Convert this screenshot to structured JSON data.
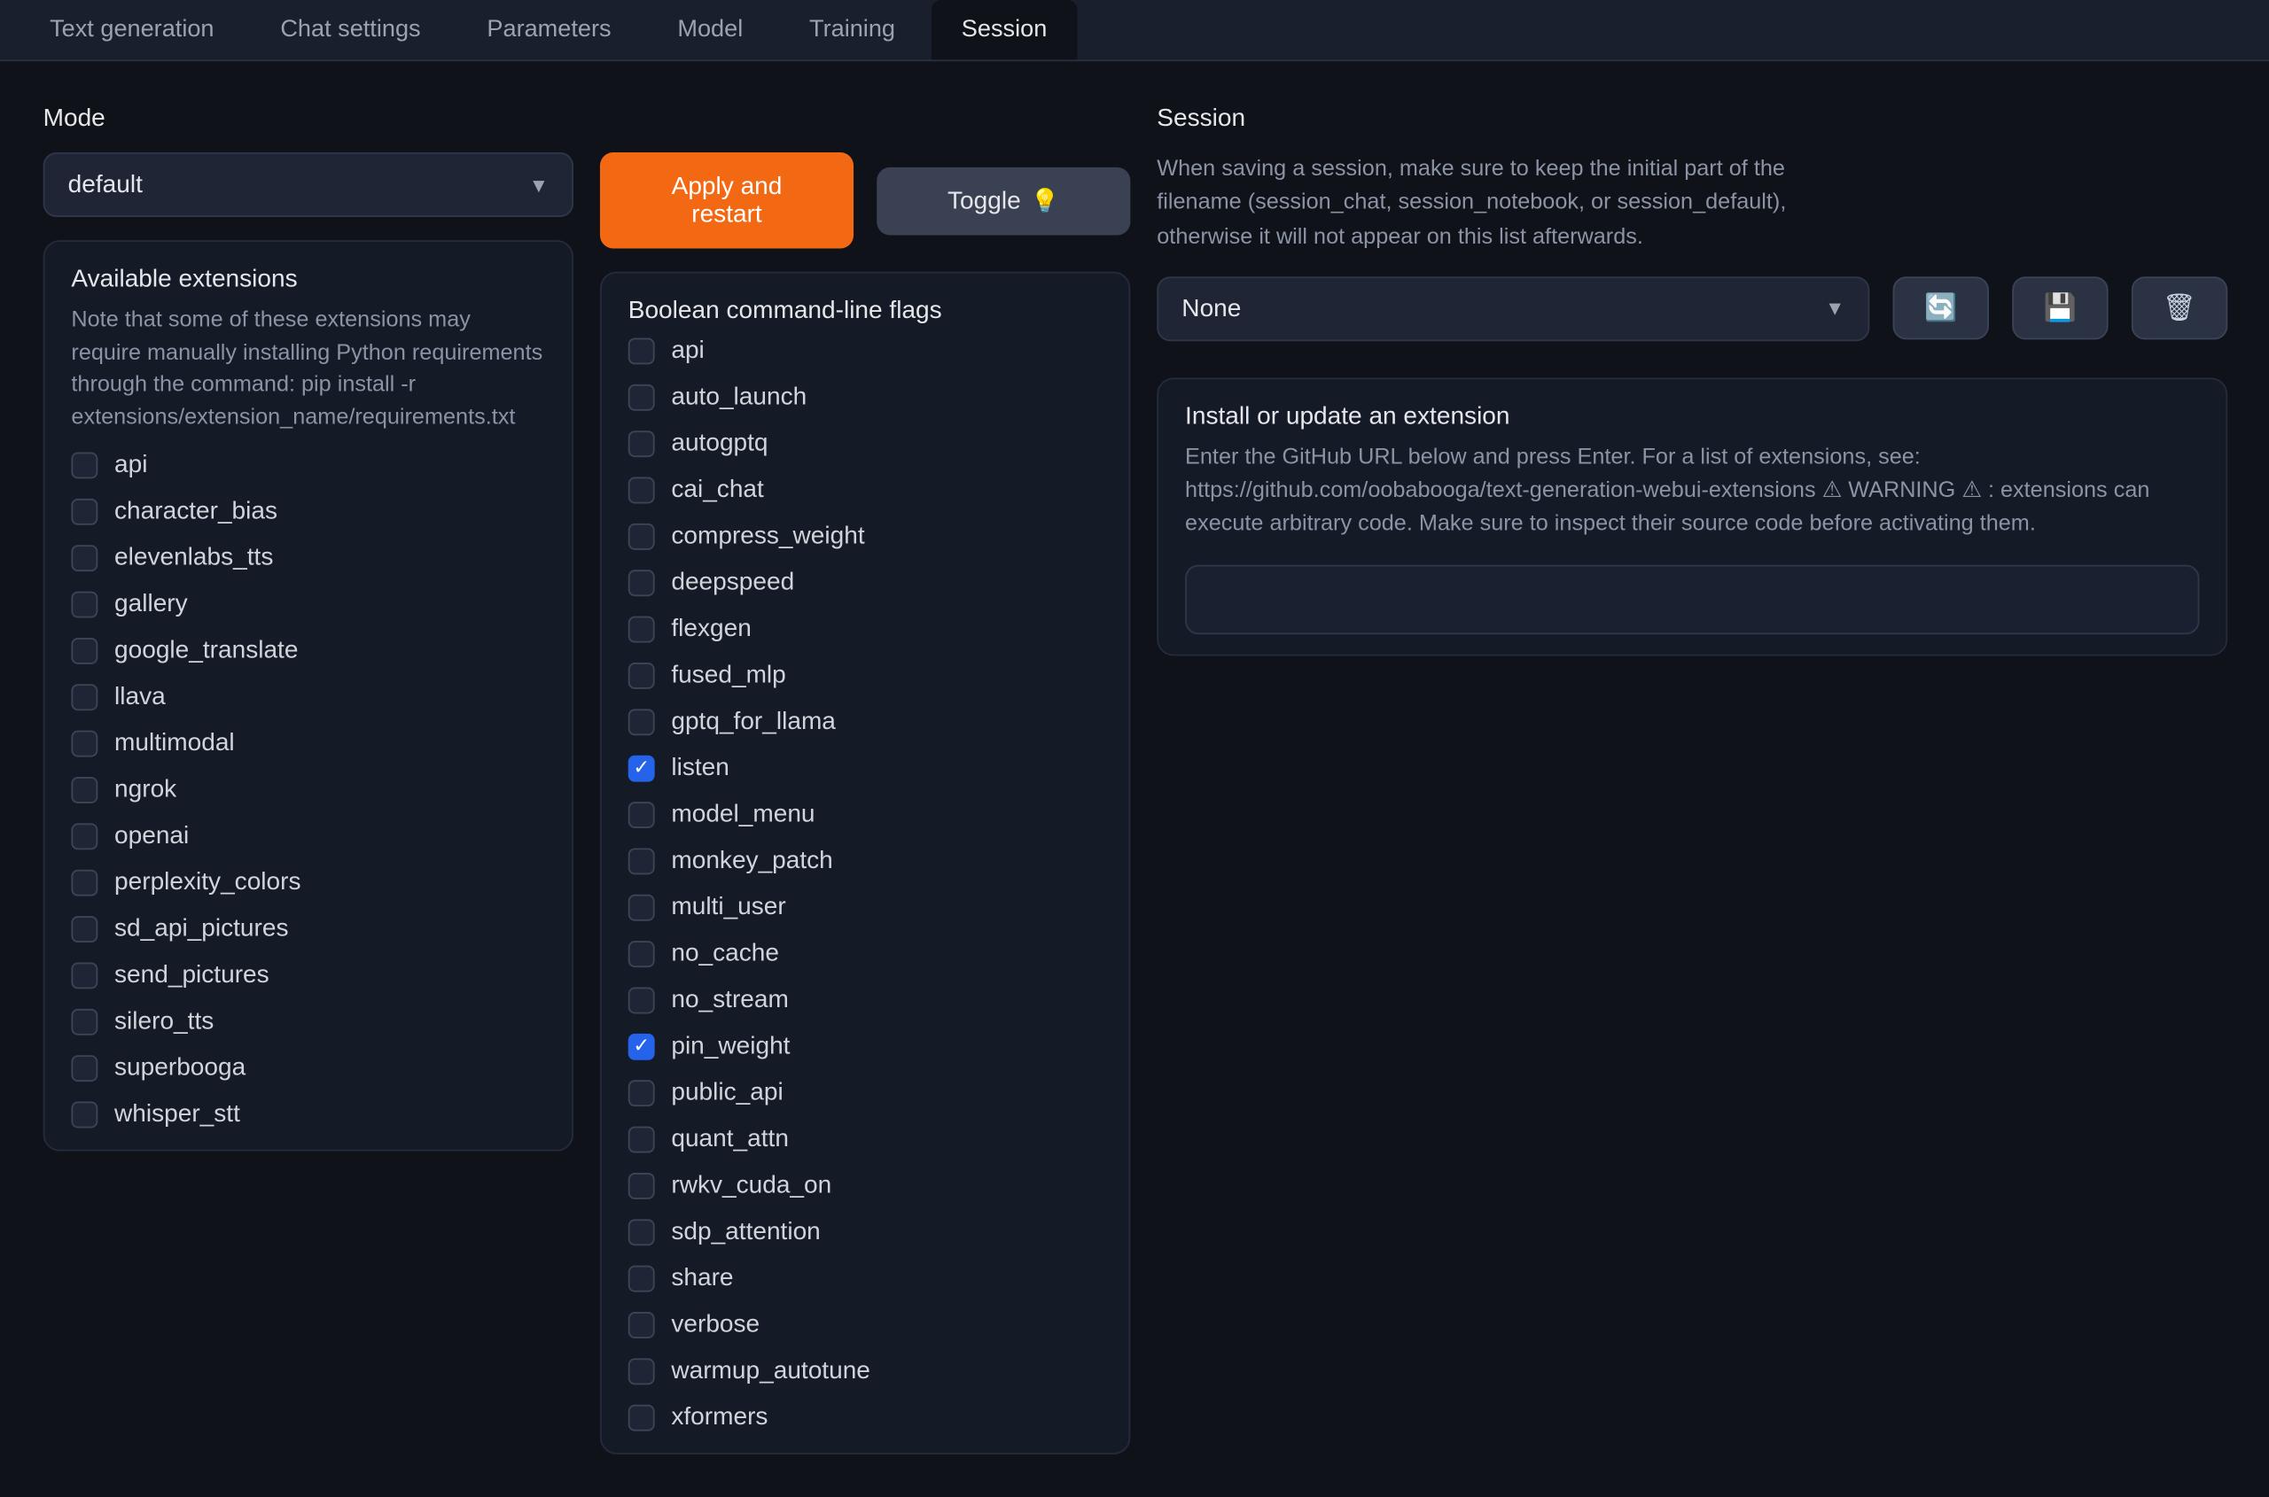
{
  "tabs": [
    "Text generation",
    "Chat settings",
    "Parameters",
    "Model",
    "Training",
    "Session"
  ],
  "active_tab": 5,
  "mode": {
    "label": "Mode",
    "value": "default"
  },
  "buttons": {
    "apply": "Apply and restart",
    "toggle": "Toggle",
    "toggle_icon": "💡"
  },
  "extensions_panel": {
    "title": "Available extensions",
    "desc": "Note that some of these extensions may require manually installing Python requirements through the command: pip install -r extensions/extension_name/requirements.txt",
    "items": [
      {
        "name": "api",
        "checked": false
      },
      {
        "name": "character_bias",
        "checked": false
      },
      {
        "name": "elevenlabs_tts",
        "checked": false
      },
      {
        "name": "gallery",
        "checked": false
      },
      {
        "name": "google_translate",
        "checked": false
      },
      {
        "name": "llava",
        "checked": false
      },
      {
        "name": "multimodal",
        "checked": false
      },
      {
        "name": "ngrok",
        "checked": false
      },
      {
        "name": "openai",
        "checked": false
      },
      {
        "name": "perplexity_colors",
        "checked": false
      },
      {
        "name": "sd_api_pictures",
        "checked": false
      },
      {
        "name": "send_pictures",
        "checked": false
      },
      {
        "name": "silero_tts",
        "checked": false
      },
      {
        "name": "superbooga",
        "checked": false
      },
      {
        "name": "whisper_stt",
        "checked": false
      }
    ]
  },
  "flags_panel": {
    "title": "Boolean command-line flags",
    "items": [
      {
        "name": "api",
        "checked": false
      },
      {
        "name": "auto_launch",
        "checked": false
      },
      {
        "name": "autogptq",
        "checked": false
      },
      {
        "name": "cai_chat",
        "checked": false
      },
      {
        "name": "compress_weight",
        "checked": false
      },
      {
        "name": "deepspeed",
        "checked": false
      },
      {
        "name": "flexgen",
        "checked": false
      },
      {
        "name": "fused_mlp",
        "checked": false
      },
      {
        "name": "gptq_for_llama",
        "checked": false
      },
      {
        "name": "listen",
        "checked": true
      },
      {
        "name": "model_menu",
        "checked": false
      },
      {
        "name": "monkey_patch",
        "checked": false
      },
      {
        "name": "multi_user",
        "checked": false
      },
      {
        "name": "no_cache",
        "checked": false
      },
      {
        "name": "no_stream",
        "checked": false
      },
      {
        "name": "pin_weight",
        "checked": true
      },
      {
        "name": "public_api",
        "checked": false
      },
      {
        "name": "quant_attn",
        "checked": false
      },
      {
        "name": "rwkv_cuda_on",
        "checked": false
      },
      {
        "name": "sdp_attention",
        "checked": false
      },
      {
        "name": "share",
        "checked": false
      },
      {
        "name": "verbose",
        "checked": false
      },
      {
        "name": "warmup_autotune",
        "checked": false
      },
      {
        "name": "xformers",
        "checked": false
      }
    ]
  },
  "session": {
    "title": "Session",
    "desc": "When saving a session, make sure to keep the initial part of the filename (session_chat, session_notebook, or session_default), otherwise it will not appear on this list afterwards.",
    "select_value": "None",
    "icons": {
      "refresh": "🔄",
      "save": "💾",
      "delete": "🗑"
    }
  },
  "install": {
    "title": "Install or update an extension",
    "desc": "Enter the GitHub URL below and press Enter. For a list of extensions, see: https://github.com/oobabooga/text-generation-webui-extensions ⚠ WARNING ⚠ : extensions can execute arbitrary code. Make sure to inspect their source code before activating them.",
    "value": ""
  }
}
